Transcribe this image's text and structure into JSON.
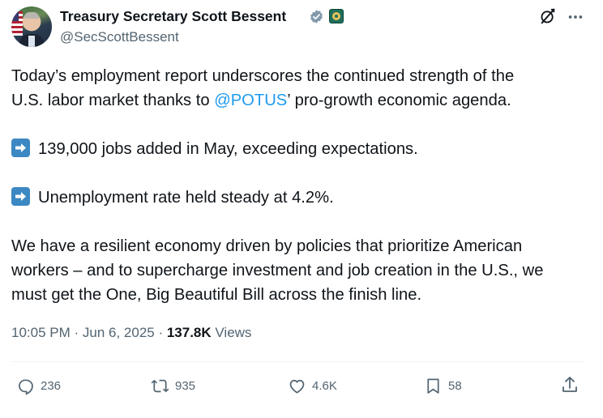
{
  "author": {
    "display_name": "Treasury Secretary Scott Bessent",
    "handle": "@SecScottBessent"
  },
  "tweet": {
    "line1_before": "Today’s employment report underscores the continued strength of the",
    "line2_before": "U.S. labor market thanks to ",
    "mention": "@POTUS",
    "line2_after": "’ pro-growth economic agenda.",
    "bullet1": "139,000 jobs added in May, exceeding expectations.",
    "bullet2": "Unemployment rate held steady at 4.2%.",
    "closing_line1": "We have a resilient economy driven by policies that prioritize American",
    "closing_line2": "workers – and to supercharge investment and job creation in the U.S., we",
    "closing_line3": "must get the One, Big Beautiful Bill across the finish line."
  },
  "meta": {
    "time": "10:05 PM",
    "separator": " · ",
    "date": "Jun 6, 2025",
    "views_count": "137.8K",
    "views_label": " Views"
  },
  "actions": {
    "replies": "236",
    "reposts": "935",
    "likes": "4.6K",
    "bookmarks": "58"
  },
  "colors": {
    "text": "#0f1419",
    "secondary": "#536471",
    "link": "#1d9bf0",
    "emoji_blue": "#3b88c3",
    "verified_grey": "#829aab"
  },
  "icons": [
    "verified-badge-icon",
    "agency-affiliate-icon",
    "grok-icon",
    "more-icon",
    "arrow-right-emoji-icon",
    "reply-icon",
    "repost-icon",
    "like-icon",
    "bookmark-icon",
    "share-icon"
  ]
}
